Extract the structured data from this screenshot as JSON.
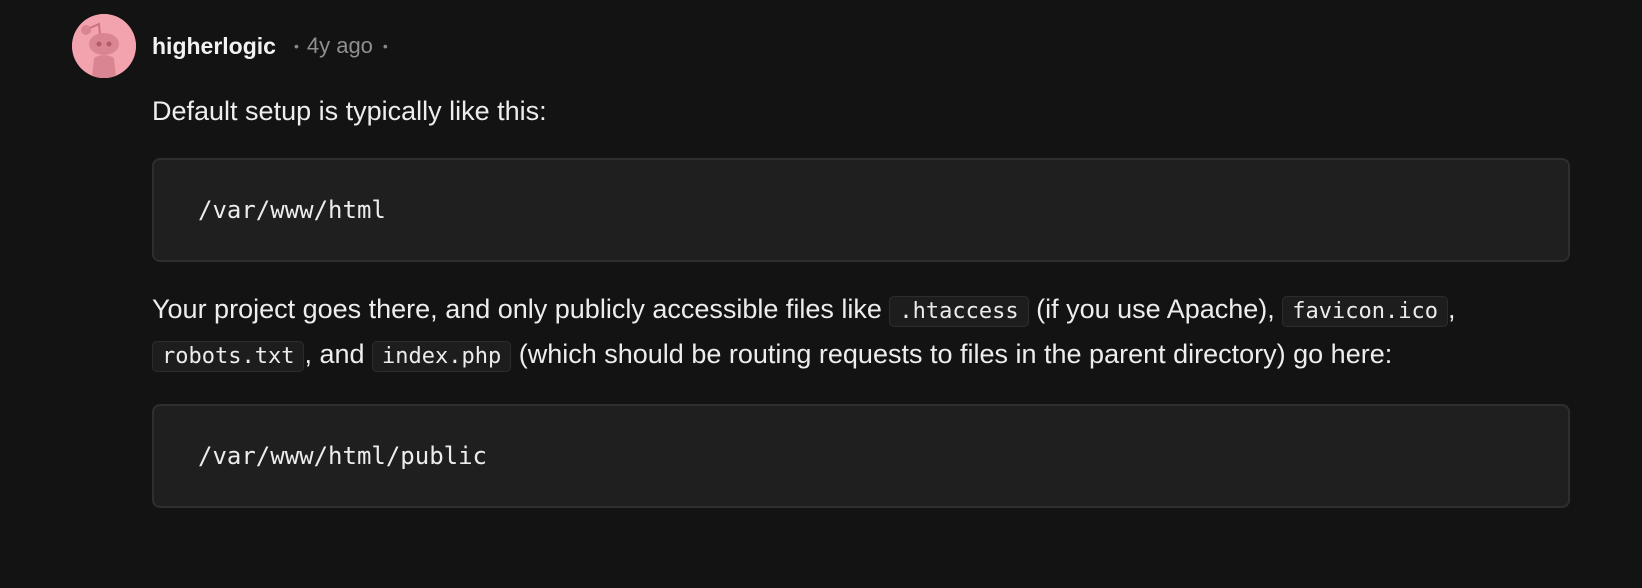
{
  "comment": {
    "author": "higherlogic",
    "separator": "•",
    "time": "4y ago",
    "separator_after": "•",
    "avatar_color": "#f3a3ae"
  },
  "content": {
    "intro": "Default setup is typically like this:",
    "code_block_1": "/var/www/html",
    "para_2": {
      "part1": "Your project goes there, and only publicly accessible files like ",
      "code1": ".htaccess",
      "part2": " (if you use Apache), ",
      "code2": "favicon.ico",
      "part3": ", ",
      "code3": "robots.txt",
      "part4": ", and ",
      "code4": "index.php",
      "part5": " (which should be routing requests to files in the parent directory) go here:"
    },
    "code_block_2": "/var/www/html/public"
  }
}
